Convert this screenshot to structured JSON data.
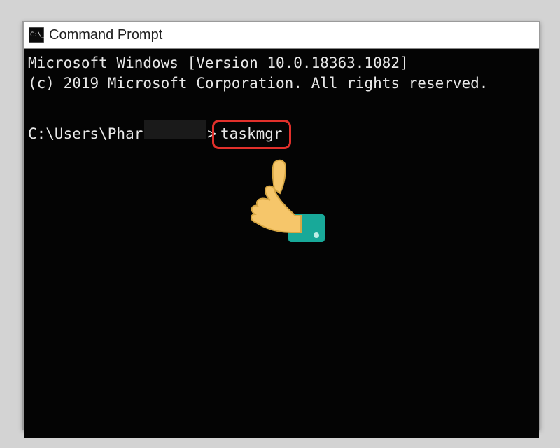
{
  "window": {
    "title": "Command Prompt"
  },
  "terminal": {
    "line1": "Microsoft Windows [Version 10.0.18363.1082]",
    "line2": "(c) 2019 Microsoft Corporation. All rights reserved.",
    "prompt_prefix": "C:\\Users\\Phar",
    "prompt_gt": ">",
    "command": "taskmgr"
  },
  "annotation": {
    "highlight_color": "#e2302b",
    "pointer_icon": "pointing-hand-icon"
  }
}
